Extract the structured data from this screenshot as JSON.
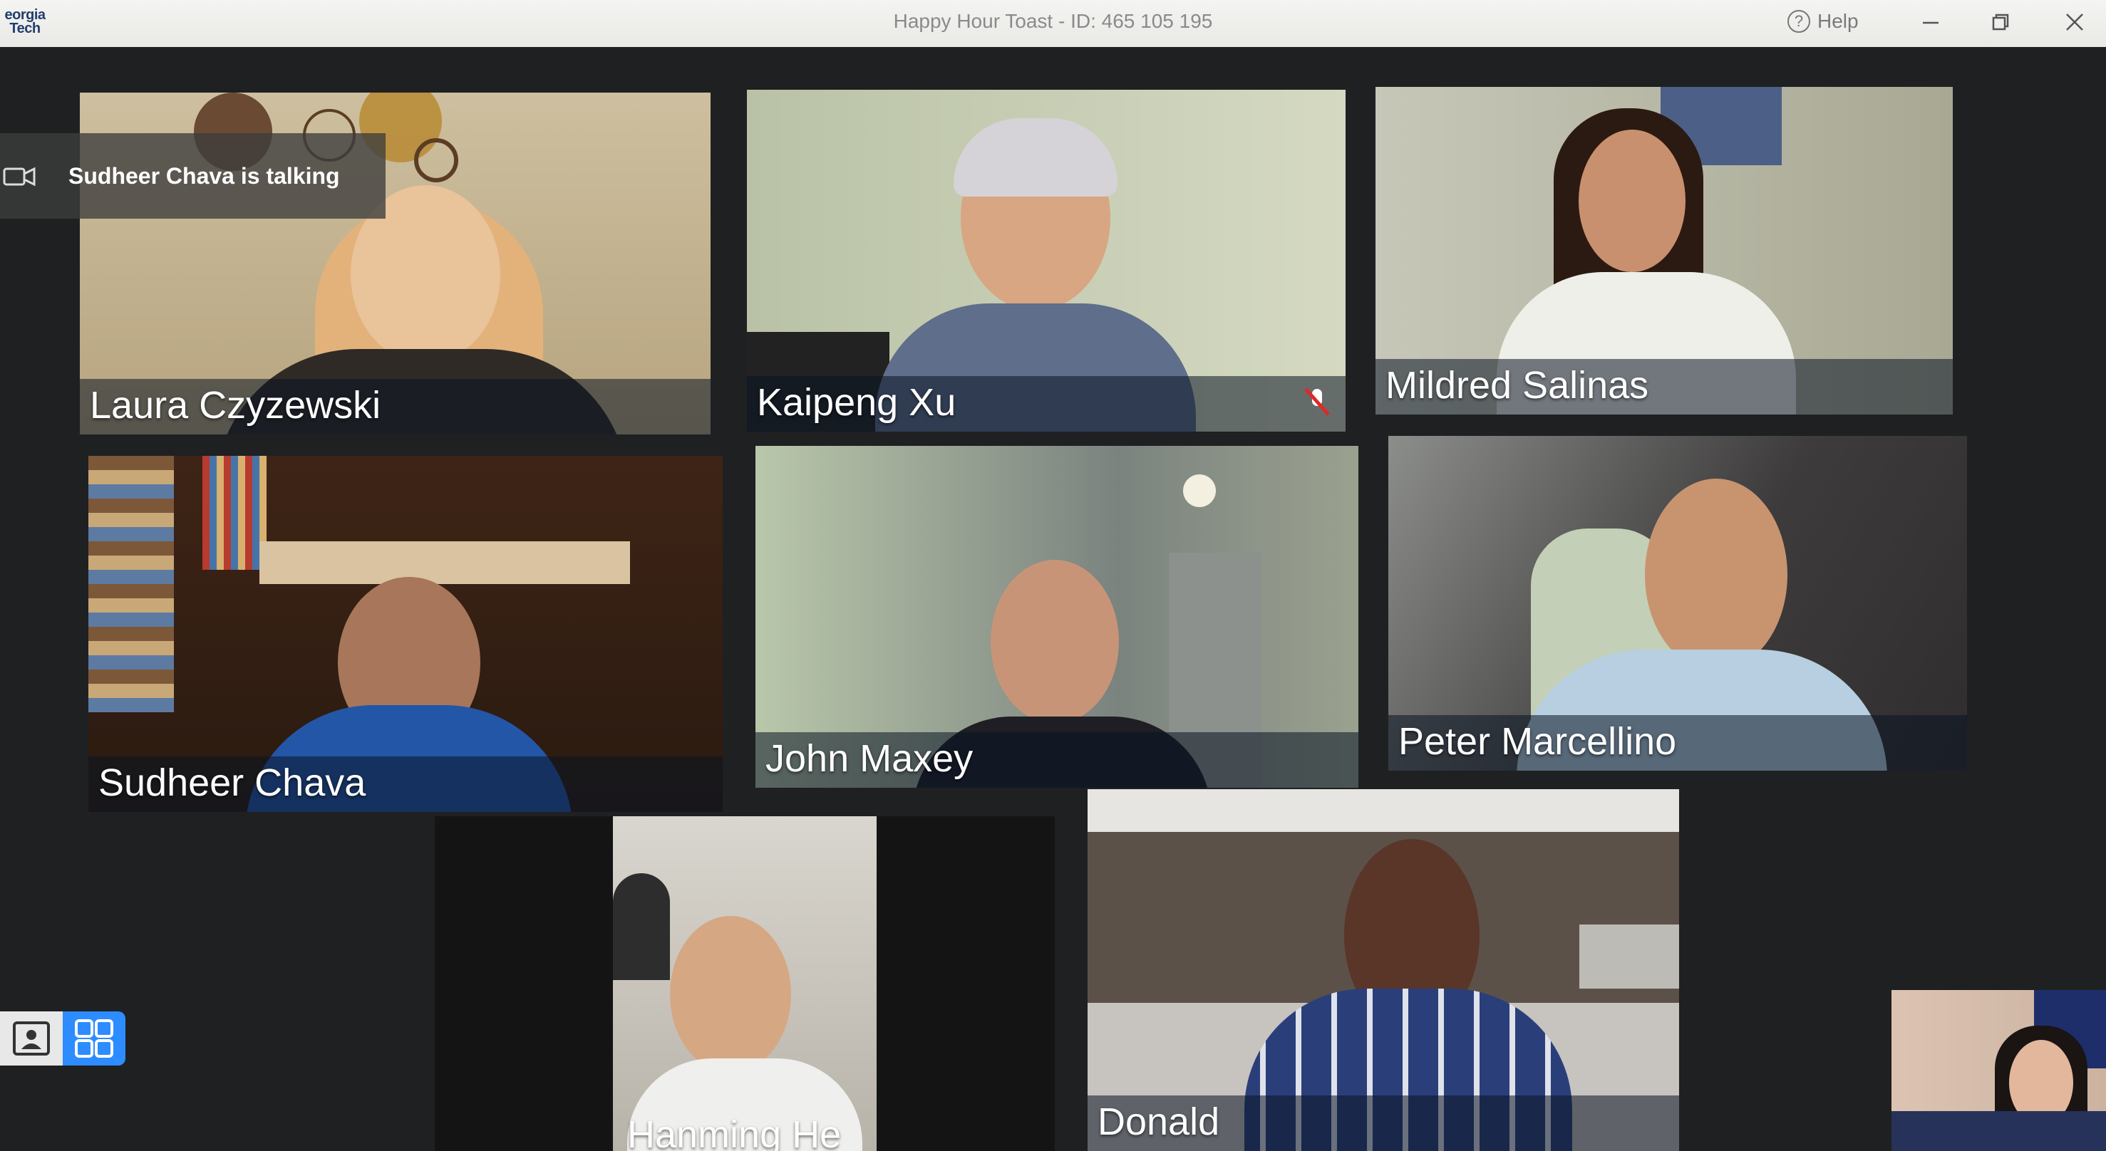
{
  "window": {
    "logo_text": "eorgia\nTech",
    "title": "Happy Hour Toast - ID: 465 105 195",
    "help_label": "Help",
    "controls": [
      "minimize-icon",
      "restore-icon",
      "close-icon"
    ]
  },
  "speaker_banner": {
    "text": "Sudheer Chava is talking",
    "icon": "video-camera-icon"
  },
  "participants": [
    {
      "name": "Laura Czyzewski"
    },
    {
      "name": "Kaipeng Xu",
      "mic_muted": true
    },
    {
      "name": "Mildred Salinas"
    },
    {
      "name": "Sudheer Chava"
    },
    {
      "name": "John Maxey"
    },
    {
      "name": "Peter Marcellino"
    },
    {
      "name": "Hanming He"
    },
    {
      "name": "Donald"
    },
    {
      "name": ""
    }
  ],
  "view_toggle": {
    "options": [
      "speaker-view-icon",
      "gallery-view-icon"
    ],
    "active": "gallery-view-icon"
  },
  "colors": {
    "accent_blue": "#2d8cff",
    "muted_red": "#e02828",
    "background": "#1f2022"
  }
}
